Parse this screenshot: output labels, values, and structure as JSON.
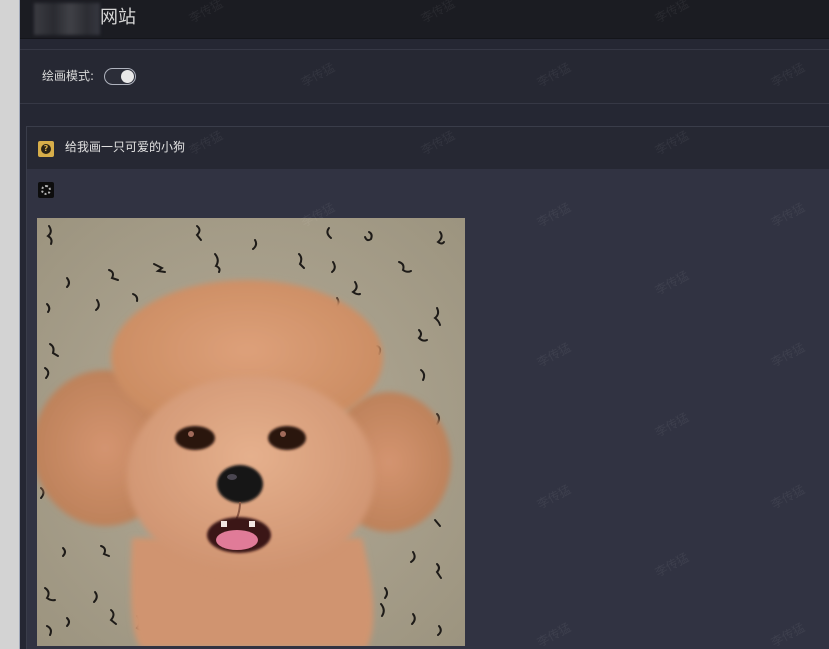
{
  "header": {
    "site_title": "网站"
  },
  "settings": {
    "drawing_mode_label": "绘画模式:",
    "drawing_mode_on": true
  },
  "conversation": {
    "user_message": "给我画一只可爱的小狗",
    "user_avatar_icon": "question-icon",
    "bot_avatar_icon": "chatgpt-logo-icon",
    "generated_image_subject": "toy poodle puppy"
  },
  "watermark_text": "李传猛",
  "colors": {
    "app_background": "#252733",
    "topbar_background": "#1b1c22",
    "bot_row_background": "#313342",
    "user_avatar": "#d7ae4a",
    "image_background": "#a69e8b",
    "dog_fur": "#d3956c"
  }
}
